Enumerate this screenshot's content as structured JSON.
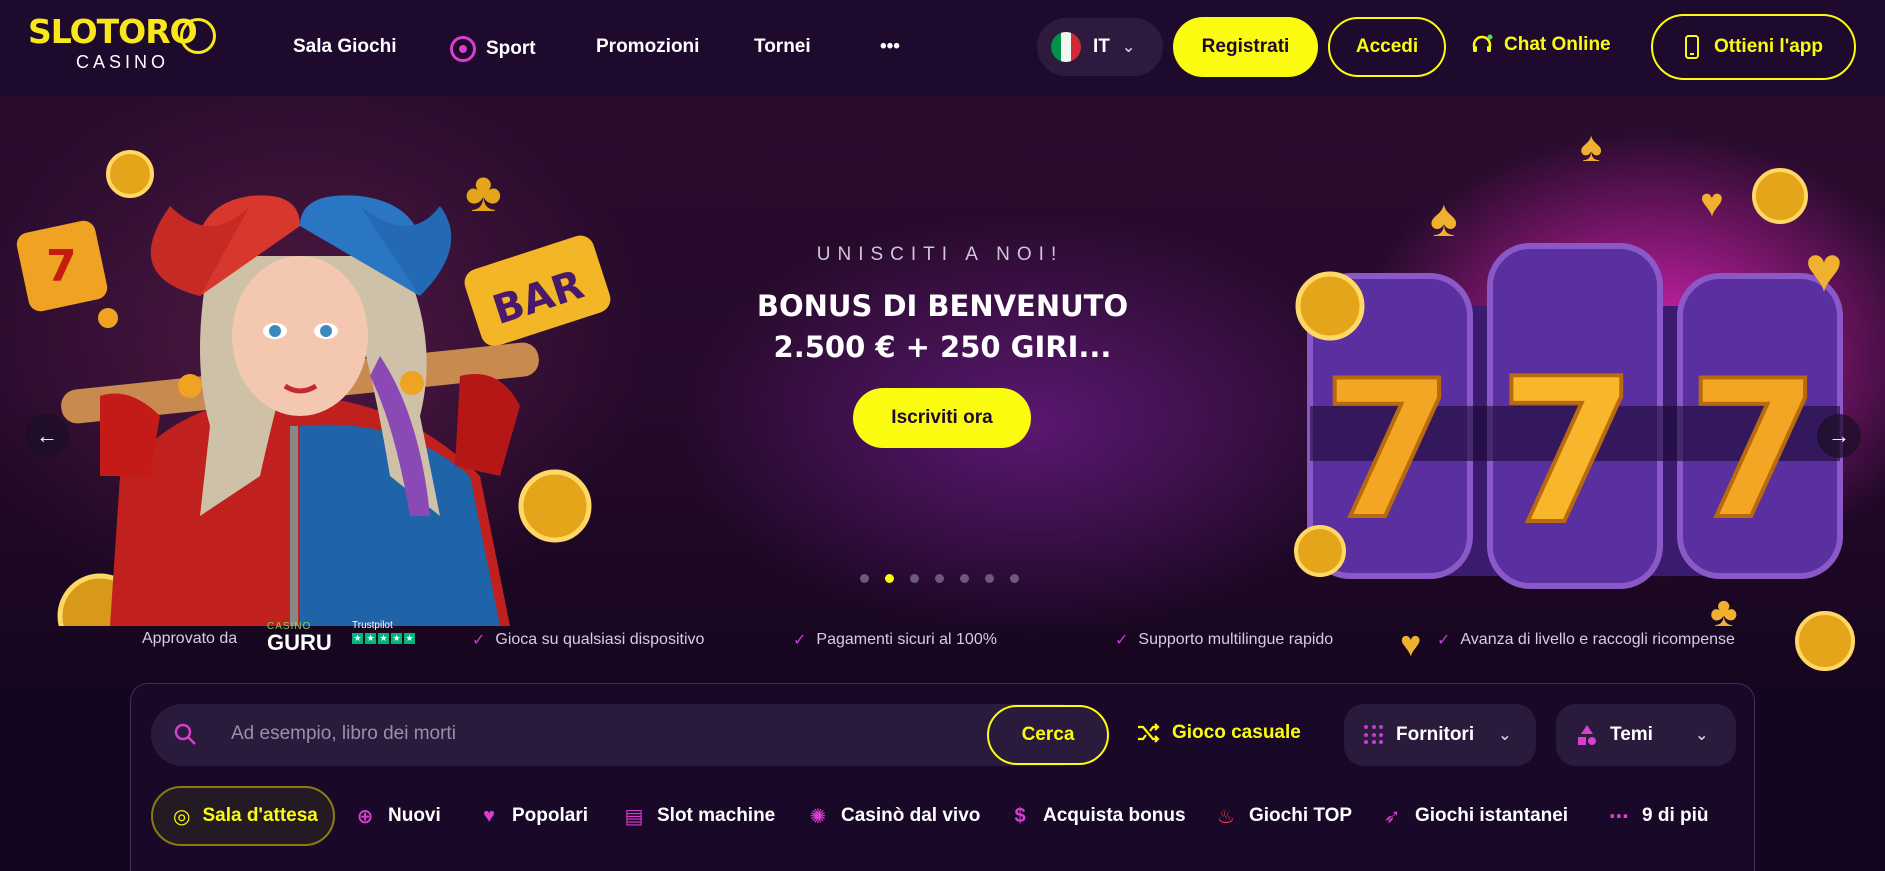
{
  "header": {
    "logo_text": "SLOTORO",
    "logo_sub": "CASINO",
    "nav": [
      {
        "label": "Sala Giochi"
      },
      {
        "label": "Sport",
        "icon": "soccer-ball-icon"
      },
      {
        "label": "Promozioni"
      },
      {
        "label": "Tornei"
      },
      {
        "label": "•••"
      }
    ],
    "language": "IT",
    "register_label": "Registrati",
    "login_label": "Accedi",
    "chat_label": "Chat Online",
    "app_label": "Ottieni l'app"
  },
  "hero": {
    "kicker": "UNISCITI A NOI!",
    "headline": "BONUS DI BENVENUTO 2.500 € + 250 GIRI...",
    "cta_label": "Iscriviti ora",
    "slide_count": 7,
    "active_slide": 2,
    "prev_icon": "←",
    "next_icon": "→"
  },
  "features": {
    "approved_by": "Approvato da",
    "casino_guru_top": "CASINO",
    "casino_guru": "GURU",
    "trustpilot": "Trustpilot",
    "items": [
      "Gioca su qualsiasi dispositivo",
      "Pagamenti sicuri al 100%",
      "Supporto multilingue rapido",
      "Avanza di livello e raccogli ricompense"
    ]
  },
  "search": {
    "placeholder": "Ad esempio, libro dei morti",
    "button_label": "Cerca",
    "casual_label": "Gioco casuale",
    "providers_label": "Fornitori",
    "themes_label": "Temi"
  },
  "categories": [
    {
      "label": "Sala d'attesa",
      "icon": "medal-icon"
    },
    {
      "label": "Nuovi",
      "icon": "plus-circle-icon"
    },
    {
      "label": "Popolari",
      "icon": "heart-icon"
    },
    {
      "label": "Slot machine",
      "icon": "slot-machine-icon"
    },
    {
      "label": "Casinò dal vivo",
      "icon": "chip-icon"
    },
    {
      "label": "Acquista bonus",
      "icon": "dollar-icon"
    },
    {
      "label": "Giochi TOP",
      "icon": "flame-icon"
    },
    {
      "label": "Giochi istantanei",
      "icon": "rocket-icon"
    },
    {
      "label": "9 di più",
      "icon": "more-dots-icon"
    }
  ],
  "colors": {
    "accent": "#fbfb10",
    "magenta": "#d83ecf",
    "header_bg": "#1d0a2c",
    "panel_bg": "#1a0828"
  }
}
